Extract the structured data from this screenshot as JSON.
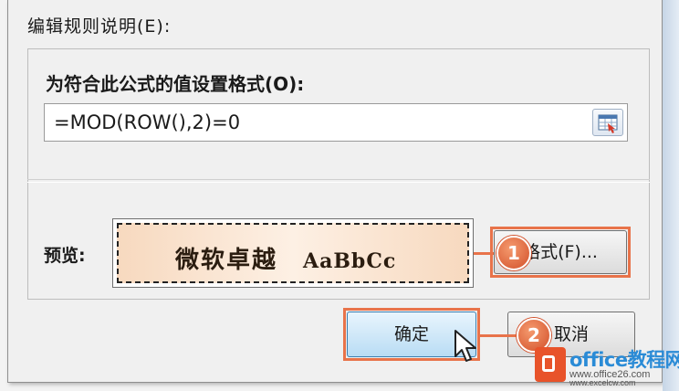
{
  "dialog": {
    "edit_rule_label": "编辑规则说明(E):",
    "formula_label": "为符合此公式的值设置格式(O):",
    "formula_value": "=MOD(ROW(),2)=0",
    "preview_label": "预览:",
    "preview_sample_cjk": "微软卓越",
    "preview_sample_latin": "AaBbCc",
    "format_button": "格式(F)...",
    "ok_button": "确定",
    "cancel_button": "取消"
  },
  "annotations": {
    "step1": "1",
    "step2": "2",
    "accent_color": "#e8734a"
  },
  "watermark": {
    "brand": "office教程网",
    "url": "www.office26.com",
    "url2": "www.excelcw.com"
  }
}
